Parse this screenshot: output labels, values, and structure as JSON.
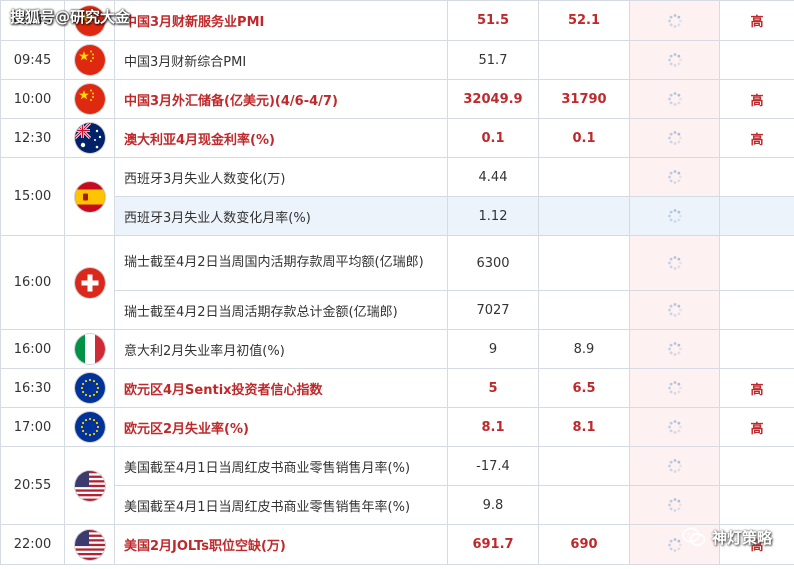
{
  "watermarks": {
    "left": "搜狐号@研究大金",
    "right": "神灯策略"
  },
  "colors": {
    "highlight_text": "#c0292b",
    "loading_column_bg": "#fdf1f1",
    "selected_row_bg": "#edf3fb",
    "border": "#d6dbe3"
  },
  "rows": [
    {
      "time": "09:45",
      "flag": "china-flag-icon",
      "name": "中国3月财新服务业PMI",
      "previous": "51.5",
      "forecast": "52.1",
      "importance": "高"
    },
    {
      "time": "09:45",
      "flag": "china-flag-icon",
      "name": "中国3月财新综合PMI",
      "previous": "51.7",
      "forecast": "",
      "importance": ""
    },
    {
      "time": "10:00",
      "flag": "china-flag-icon",
      "name": "中国3月外汇储备(亿美元)(4/6-4/7)",
      "previous": "32049.9",
      "forecast": "31790",
      "importance": "高"
    },
    {
      "time": "12:30",
      "flag": "australia-flag-icon",
      "name": "澳大利亚4月现金利率(%)",
      "previous": "0.1",
      "forecast": "0.1",
      "importance": "高"
    },
    {
      "time": "15:00",
      "flag": "spain-flag-icon",
      "name": "西班牙3月失业人数变化(万)",
      "previous": "4.44",
      "forecast": "",
      "importance": ""
    },
    {
      "time": "",
      "flag": "",
      "name": "西班牙3月失业人数变化月率(%)",
      "previous": "1.12",
      "forecast": "",
      "importance": ""
    },
    {
      "time": "16:00",
      "flag": "switzerland-flag-icon",
      "name": "瑞士截至4月2日当周国内活期存款周平均额(亿瑞郎)",
      "previous": "6300",
      "forecast": "",
      "importance": ""
    },
    {
      "time": "",
      "flag": "",
      "name": "瑞士截至4月2日当周活期存款总计金额(亿瑞郎)",
      "previous": "7027",
      "forecast": "",
      "importance": ""
    },
    {
      "time": "16:00",
      "flag": "italy-flag-icon",
      "name": "意大利2月失业率月初值(%)",
      "previous": "9",
      "forecast": "8.9",
      "importance": ""
    },
    {
      "time": "16:30",
      "flag": "eu-flag-icon",
      "name": "欧元区4月Sentix投资者信心指数",
      "previous": "5",
      "forecast": "6.5",
      "importance": "高"
    },
    {
      "time": "17:00",
      "flag": "eu-flag-icon",
      "name": "欧元区2月失业率(%)",
      "previous": "8.1",
      "forecast": "8.1",
      "importance": "高"
    },
    {
      "time": "20:55",
      "flag": "usa-flag-icon",
      "name": "美国截至4月1日当周红皮书商业零售销售月率(%)",
      "previous": "-17.4",
      "forecast": "",
      "importance": ""
    },
    {
      "time": "",
      "flag": "",
      "name": "美国截至4月1日当周红皮书商业零售销售年率(%)",
      "previous": "9.8",
      "forecast": "",
      "importance": ""
    },
    {
      "time": "22:00",
      "flag": "usa-flag-icon",
      "name": "美国2月JOLTs职位空缺(万)",
      "previous": "691.7",
      "forecast": "690",
      "importance": "高"
    }
  ]
}
